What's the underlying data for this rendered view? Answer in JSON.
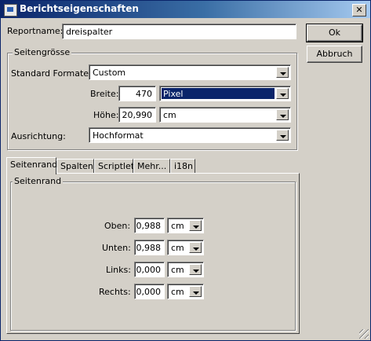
{
  "window": {
    "title": "Berichtseigenschaften",
    "close_glyph": "✕"
  },
  "reportname": {
    "label": "Reportname:",
    "value": "dreispalter"
  },
  "buttons": {
    "ok": "Ok",
    "cancel": "Abbruch"
  },
  "seitengroesse": {
    "legend": "Seitengrösse",
    "standard_label": "Standard Formate:",
    "standard_value": "Custom",
    "breite_label": "Breite:",
    "breite_value": "470",
    "breite_unit": "Pixel",
    "hoehe_label": "Höhe:",
    "hoehe_value": "20,990",
    "hoehe_unit": "cm",
    "ausrichtung_label": "Ausrichtung:",
    "ausrichtung_value": "Hochformat"
  },
  "tabs": [
    {
      "label": "Seitenrand"
    },
    {
      "label": "Spalten"
    },
    {
      "label": "Scriptlet"
    },
    {
      "label": "Mehr..."
    },
    {
      "label": "i18n"
    }
  ],
  "seitenrand": {
    "legend": "Seitenrand",
    "rows": [
      {
        "label": "Oben:",
        "value": "0,988",
        "unit": "cm"
      },
      {
        "label": "Unten:",
        "value": "0,988",
        "unit": "cm"
      },
      {
        "label": "Links:",
        "value": "0,000",
        "unit": "cm"
      },
      {
        "label": "Rechts:",
        "value": "0,000",
        "unit": "cm"
      }
    ]
  }
}
